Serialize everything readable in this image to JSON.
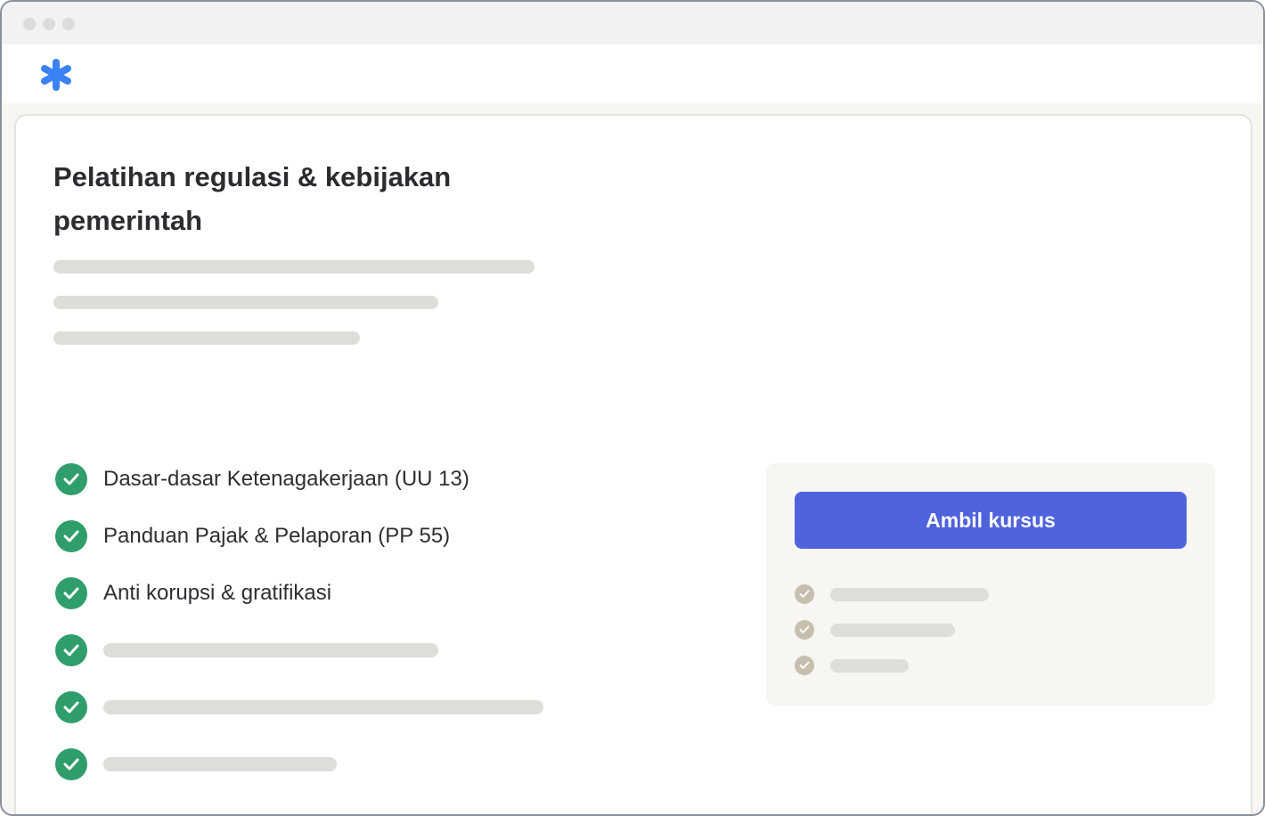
{
  "window": {
    "controls": [
      "close",
      "minimize",
      "maximize"
    ],
    "logo_icon": "asterisk-logo-icon",
    "accent_color": "#3b82f6"
  },
  "course": {
    "title": "Pelatihan regulasi & kebijakan pemerintah",
    "topics": [
      {
        "label": "Dasar-dasar Ketenagakerjaan (UU 13)",
        "icon": "check-circle-icon"
      },
      {
        "label": "Panduan Pajak & Pelaporan (PP 55)",
        "icon": "check-circle-icon"
      },
      {
        "label": "Anti korupsi & gratifikasi",
        "icon": "check-circle-icon"
      }
    ],
    "check_color": "#2f9e6b"
  },
  "enroll": {
    "button_label": "Ambil kursus",
    "button_color": "#4f63dc",
    "inclusion_icon": "check-circle-icon",
    "inclusion_check_color": "#c6bfae"
  }
}
